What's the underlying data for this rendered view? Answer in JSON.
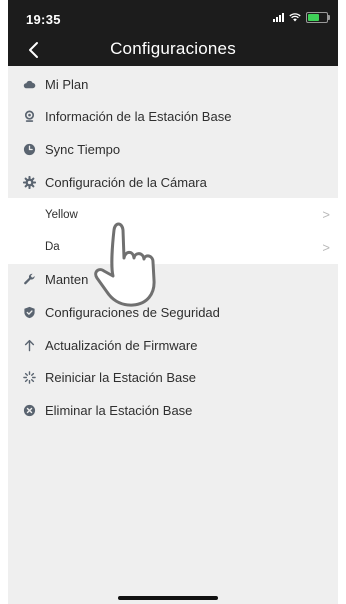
{
  "status_bar": {
    "time": "19:35"
  },
  "nav": {
    "title": "Configuraciones"
  },
  "menu": {
    "items_top": [
      {
        "label": "Mi Plan",
        "icon": "cloud-icon"
      },
      {
        "label": "Información de la Estación Base",
        "icon": "webcam-icon"
      },
      {
        "label": "Sync Tiempo",
        "icon": "clock-icon"
      },
      {
        "label": "Configuración de la Cámara",
        "icon": "gear-icon"
      }
    ],
    "camera_subitems": [
      {
        "label": "Yellow"
      },
      {
        "label": "Da"
      }
    ],
    "items_bottom": [
      {
        "label": "Manten",
        "icon": "wrench-icon"
      },
      {
        "label": "Configuraciones de Seguridad",
        "icon": "shield-icon"
      },
      {
        "label": "Actualización de Firmware",
        "icon": "arrow-up-icon"
      },
      {
        "label": "Reiniciar la Estación Base",
        "icon": "loading-icon"
      },
      {
        "label": "Eliminar la Estación Base",
        "icon": "remove-icon"
      }
    ]
  },
  "colors": {
    "header_bg": "#1c1c1c",
    "list_bg": "#efefef",
    "icon_color": "#5a6470"
  }
}
